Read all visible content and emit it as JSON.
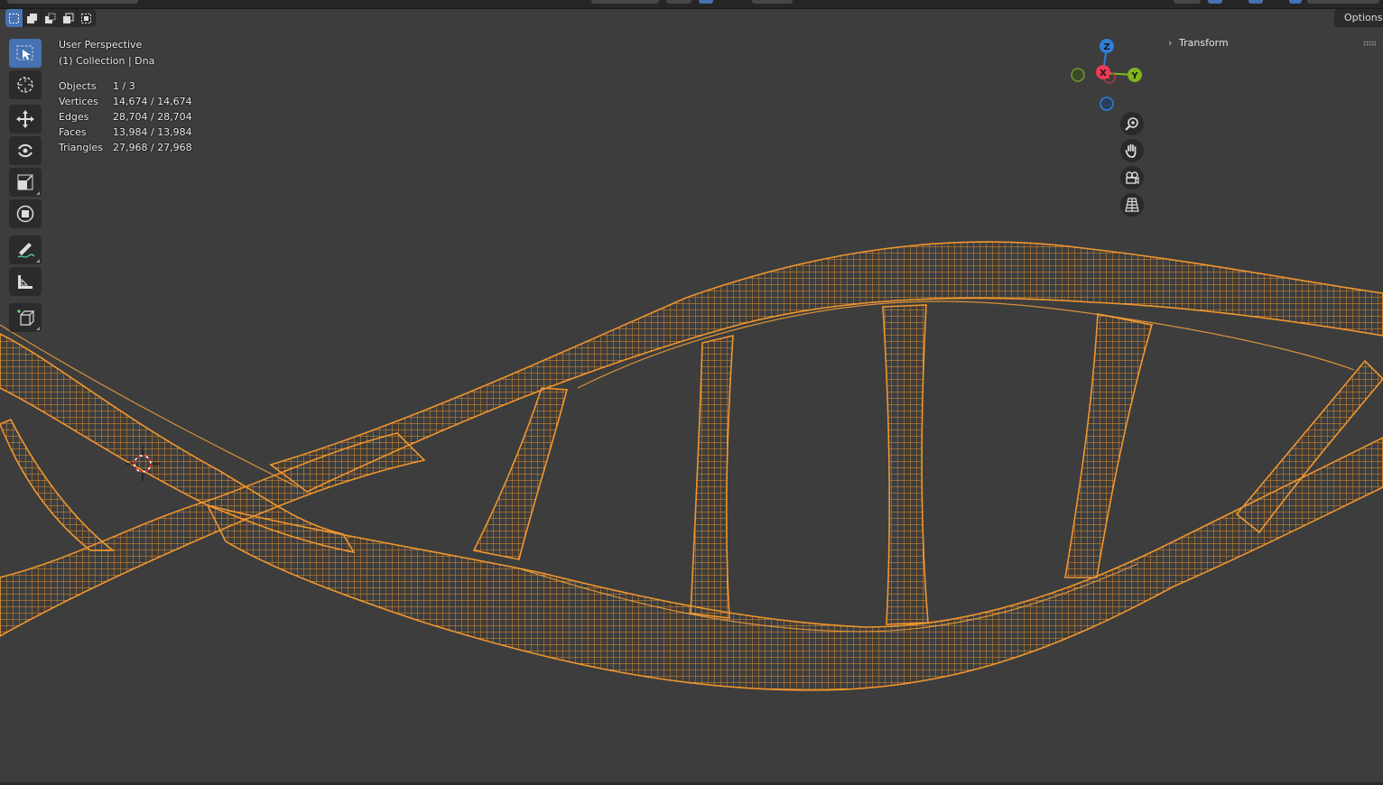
{
  "viewport": {
    "perspective_label": "User Perspective",
    "collection_label": "(1) Collection | Dna"
  },
  "stats": [
    {
      "label": "Objects",
      "value": "1 / 3"
    },
    {
      "label": "Vertices",
      "value": "14,674 / 14,674"
    },
    {
      "label": "Edges",
      "value": "28,704 / 28,704"
    },
    {
      "label": "Faces",
      "value": "13,984 / 13,984"
    },
    {
      "label": "Triangles",
      "value": "27,968 / 27,968"
    }
  ],
  "header": {
    "options_label": "Options"
  },
  "sidebar": {
    "transform_label": "Transform"
  },
  "gizmo": {
    "x_label": "X",
    "y_label": "Y",
    "z_label": "Z"
  },
  "toolbar": {
    "tools": [
      "select-box-icon",
      "cursor-icon",
      "move-icon",
      "rotate-icon",
      "scale-icon",
      "transform-icon",
      "annotate-icon",
      "measure-icon",
      "add-cube-icon"
    ]
  },
  "colors": {
    "background": "#3d3d3d",
    "wire": "#f0962e",
    "accent": "#4772b3",
    "axis_x": "#f03a54",
    "axis_y": "#7fb61e",
    "axis_z": "#2e7fdc"
  }
}
